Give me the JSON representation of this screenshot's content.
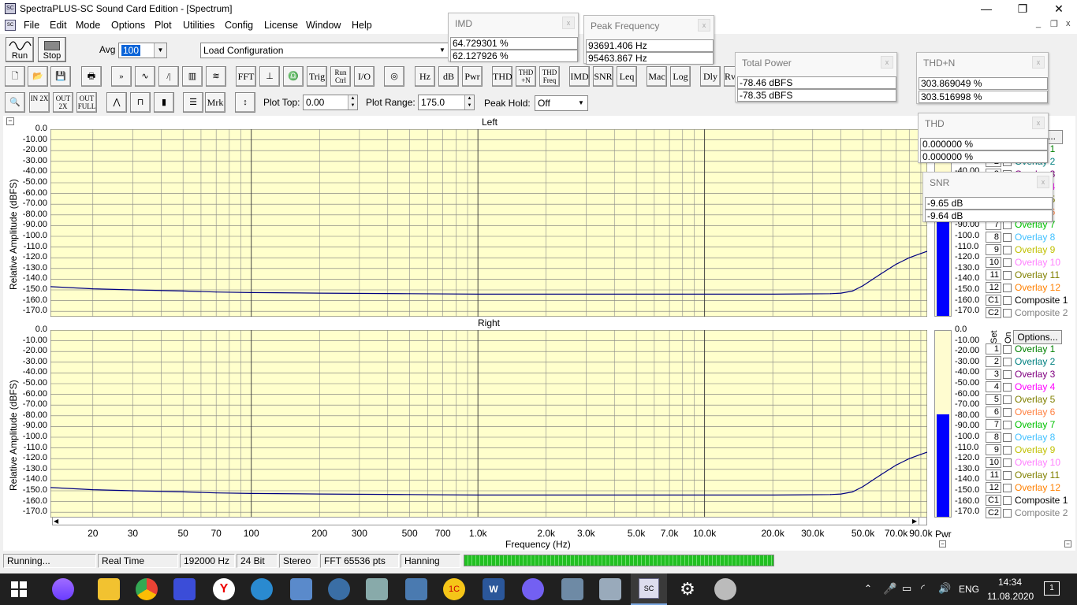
{
  "window": {
    "title": "SpectraPLUS-SC Sound Card Edition - [Spectrum]",
    "min": "—",
    "restore": "❐",
    "close": "✕",
    "icon_text": "SC"
  },
  "menu": [
    "File",
    "Edit",
    "Mode",
    "Options",
    "Plot",
    "Utilities",
    "Config",
    "License",
    "Window",
    "Help"
  ],
  "mdi_controls": [
    "_",
    "❐",
    "x"
  ],
  "toolbar": {
    "run_label": "Run",
    "stop_label": "Stop",
    "avg_label": "Avg",
    "avg_value": "100",
    "config_value": "Load Configuration",
    "buttons_row1": [
      "FFT",
      "Trig",
      "Run Ctrl",
      "I/O",
      "Hz",
      "dB",
      "Pwr",
      "THD",
      "THD +N",
      "THD Freq",
      "IMD",
      "SNR",
      "Leq",
      "Mac",
      "Log",
      "Dly",
      "Rv"
    ],
    "buttons_row2": [
      "IN 2X",
      "OUT 2X",
      "OUT FULL",
      "Mrk"
    ],
    "plot_top_label": "Plot Top:",
    "plot_top_value": "0.00",
    "plot_range_label": "Plot Range:",
    "plot_range_value": "175.0",
    "peak_hold_label": "Peak Hold:",
    "peak_hold_value": "Off"
  },
  "panels": {
    "imd": {
      "title": "IMD",
      "v1": "64.729301 %",
      "v2": "62.127926 %"
    },
    "peak": {
      "title": "Peak Frequency",
      "v1": "93691.406 Hz",
      "v2": "95463.867 Hz"
    },
    "power": {
      "title": "Total Power",
      "v1": "-78.46 dBFS",
      "v2": "-78.35 dBFS"
    },
    "thdn": {
      "title": "THD+N",
      "v1": "303.869049 %",
      "v2": "303.516998 %"
    },
    "thd": {
      "title": "THD",
      "v1": "0.000000 %",
      "v2": "0.000000 %"
    },
    "snr": {
      "title": "SNR",
      "v1": "-9.65 dB",
      "v2": "-9.64 dB"
    }
  },
  "plots": {
    "left_title": "Left",
    "right_title": "Right",
    "ylabel": "Relative Amplitude (dBFS)",
    "xlabel": "Frequency (Hz)",
    "y_ticks": [
      "0.0",
      "-10.00",
      "-20.00",
      "-30.00",
      "-40.00",
      "-50.00",
      "-60.00",
      "-70.00",
      "-80.00",
      "-90.00",
      "-100.0",
      "-110.0",
      "-120.0",
      "-130.0",
      "-140.0",
      "-150.0",
      "-160.0",
      "-170.0"
    ],
    "x_ticks": [
      "20",
      "30",
      "50",
      "70",
      "100",
      "200",
      "300",
      "500",
      "700",
      "1.0k",
      "2.0k",
      "3.0k",
      "5.0k",
      "7.0k",
      "10.0k",
      "20.0k",
      "30.0k",
      "50.0k",
      "70.0k",
      "90.0k"
    ],
    "pwr_label": "Pwr",
    "options_label": "Options...",
    "set_label": "Set",
    "on_label": "On"
  },
  "overlays": [
    {
      "n": "1",
      "name": "Overlay 1",
      "color": "#008000"
    },
    {
      "n": "2",
      "name": "Overlay 2",
      "color": "#008080"
    },
    {
      "n": "3",
      "name": "Overlay 3",
      "color": "#800080"
    },
    {
      "n": "4",
      "name": "Overlay 4",
      "color": "#ff00ff"
    },
    {
      "n": "5",
      "name": "Overlay 5",
      "color": "#808000"
    },
    {
      "n": "6",
      "name": "Overlay 6",
      "color": "#ff8040"
    },
    {
      "n": "7",
      "name": "Overlay 7",
      "color": "#00c000"
    },
    {
      "n": "8",
      "name": "Overlay 8",
      "color": "#40c0ff"
    },
    {
      "n": "9",
      "name": "Overlay 9",
      "color": "#c0c000"
    },
    {
      "n": "10",
      "name": "Overlay 10",
      "color": "#ff80ff"
    },
    {
      "n": "11",
      "name": "Overlay 11",
      "color": "#808000"
    },
    {
      "n": "12",
      "name": "Overlay 12",
      "color": "#ff8000"
    },
    {
      "n": "C1",
      "name": "Composite 1",
      "color": "#000000"
    },
    {
      "n": "C2",
      "name": "Composite 2",
      "color": "#808080"
    }
  ],
  "chart_data": [
    {
      "type": "line",
      "title": "Left",
      "xlabel": "Frequency (Hz)",
      "ylabel": "Relative Amplitude (dBFS)",
      "xscale": "log",
      "xlim": [
        13,
        96000
      ],
      "ylim": [
        -175,
        0
      ],
      "grid": true,
      "series": [
        {
          "color": "#000080",
          "x": [
            13,
            20,
            30,
            50,
            70,
            100,
            200,
            500,
            1000,
            2000,
            5000,
            10000,
            20000,
            36000,
            40000,
            45000,
            50000,
            60000,
            70000,
            80000,
            90000,
            96000
          ],
          "y": [
            -147,
            -149,
            -150,
            -151,
            -152,
            -152.5,
            -153,
            -153.5,
            -154,
            -154,
            -154,
            -154,
            -154,
            -153.5,
            -153,
            -151,
            -146,
            -135,
            -126,
            -120,
            -116,
            -114
          ]
        }
      ]
    },
    {
      "type": "line",
      "title": "Right",
      "xlabel": "Frequency (Hz)",
      "ylabel": "Relative Amplitude (dBFS)",
      "xscale": "log",
      "xlim": [
        13,
        96000
      ],
      "ylim": [
        -175,
        0
      ],
      "grid": true,
      "series": [
        {
          "color": "#000080",
          "x": [
            13,
            20,
            30,
            50,
            70,
            100,
            200,
            500,
            1000,
            2000,
            5000,
            10000,
            20000,
            36000,
            40000,
            45000,
            50000,
            60000,
            70000,
            80000,
            90000,
            96000
          ],
          "y": [
            -147,
            -149,
            -150,
            -151,
            -152,
            -152.5,
            -153,
            -153.5,
            -154,
            -154,
            -154,
            -154,
            -154,
            -153.5,
            -153,
            -151,
            -146,
            -135,
            -126,
            -120,
            -116,
            -114
          ]
        }
      ]
    }
  ],
  "pwr_level": -78.4,
  "status": [
    "Running...",
    "Real Time",
    "192000 Hz",
    "24 Bit",
    "Stereo",
    "FFT 65536 pts",
    "Hanning"
  ],
  "tray": {
    "lang": "ENG",
    "time": "14:34",
    "date": "11.08.2020",
    "notif": "1"
  }
}
